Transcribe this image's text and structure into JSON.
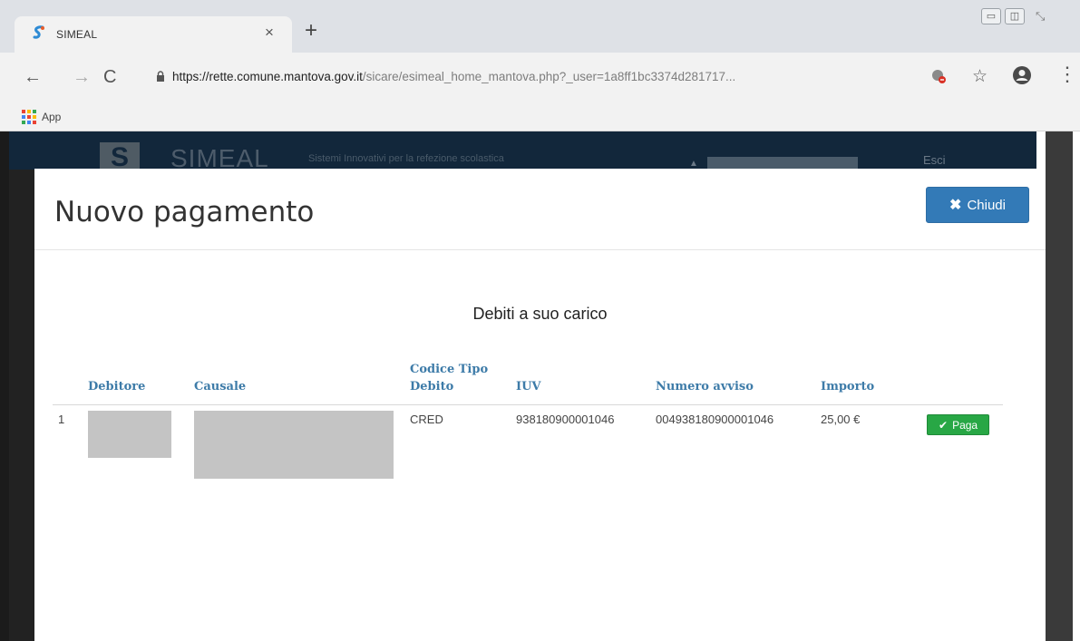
{
  "browser": {
    "tab_title": "SIMEAL",
    "new_tab_symbol": "+",
    "close_tab_symbol": "×",
    "url_host": "https://rette.comune.mantova.gov.it",
    "url_path": "/sicare/esimeal_home_mantova.php?_user=1a8ff1bc3374d281717...",
    "bookmarks_label": "App",
    "apps_colors": [
      "#ea4335",
      "#fbbc05",
      "#34a853",
      "#4285f4",
      "#ea4335",
      "#fbbc05",
      "#34a853",
      "#4285f4",
      "#ea4335"
    ]
  },
  "background_page": {
    "logo_letter": "S",
    "brand": "SIMEAL",
    "subtitle": "Sistemi Innovativi per la refezione scolastica",
    "logout": "Esci"
  },
  "modal": {
    "title": "Nuovo pagamento",
    "close_label": "Chiudi",
    "section_title": "Debiti a suo carico",
    "columns": {
      "debitore": "Debitore",
      "causale": "Causale",
      "codice_tipo_1": "Codice Tipo",
      "codice_tipo_2": "Debito",
      "iuv": "IUV",
      "numero_avviso": "Numero avviso",
      "importo": "Importo"
    },
    "rows": [
      {
        "index": "1",
        "codice_tipo_debito": "CRED",
        "iuv": "938180900001046",
        "numero_avviso": "004938180900001046",
        "importo": "25,00 €",
        "pay_label": "Paga"
      }
    ]
  },
  "colors": {
    "primary": "#337ab7",
    "success": "#28a745",
    "header_text": "#3d7ba8"
  }
}
